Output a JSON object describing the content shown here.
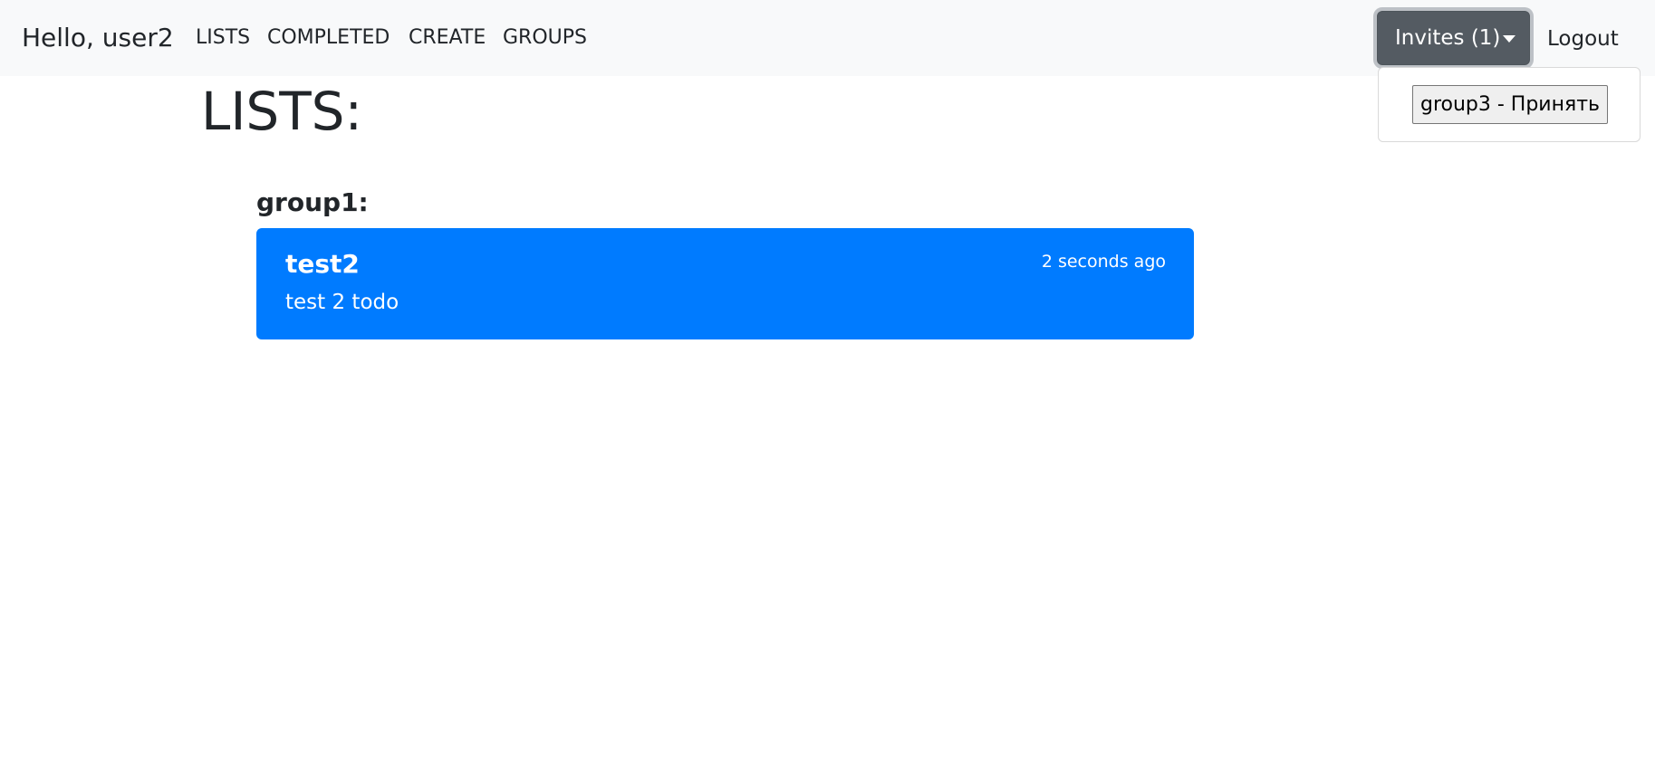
{
  "navbar": {
    "brand": "Hello, user2",
    "links": [
      "LISTS",
      "COMPLETED",
      "CREATE",
      "GROUPS"
    ],
    "invites_label": "Invites (1)",
    "logout_label": "Logout"
  },
  "invites_dropdown": {
    "items": [
      "group3 - Принять"
    ]
  },
  "main": {
    "title": "LISTS:",
    "groups": [
      {
        "name": "group1:",
        "lists": [
          {
            "title": "test2",
            "time": "2 seconds ago",
            "description": "test 2 todo"
          }
        ]
      }
    ]
  },
  "colors": {
    "navbar_bg": "#f8f9fa",
    "primary": "#007bff",
    "secondary_active": "#545b62"
  }
}
